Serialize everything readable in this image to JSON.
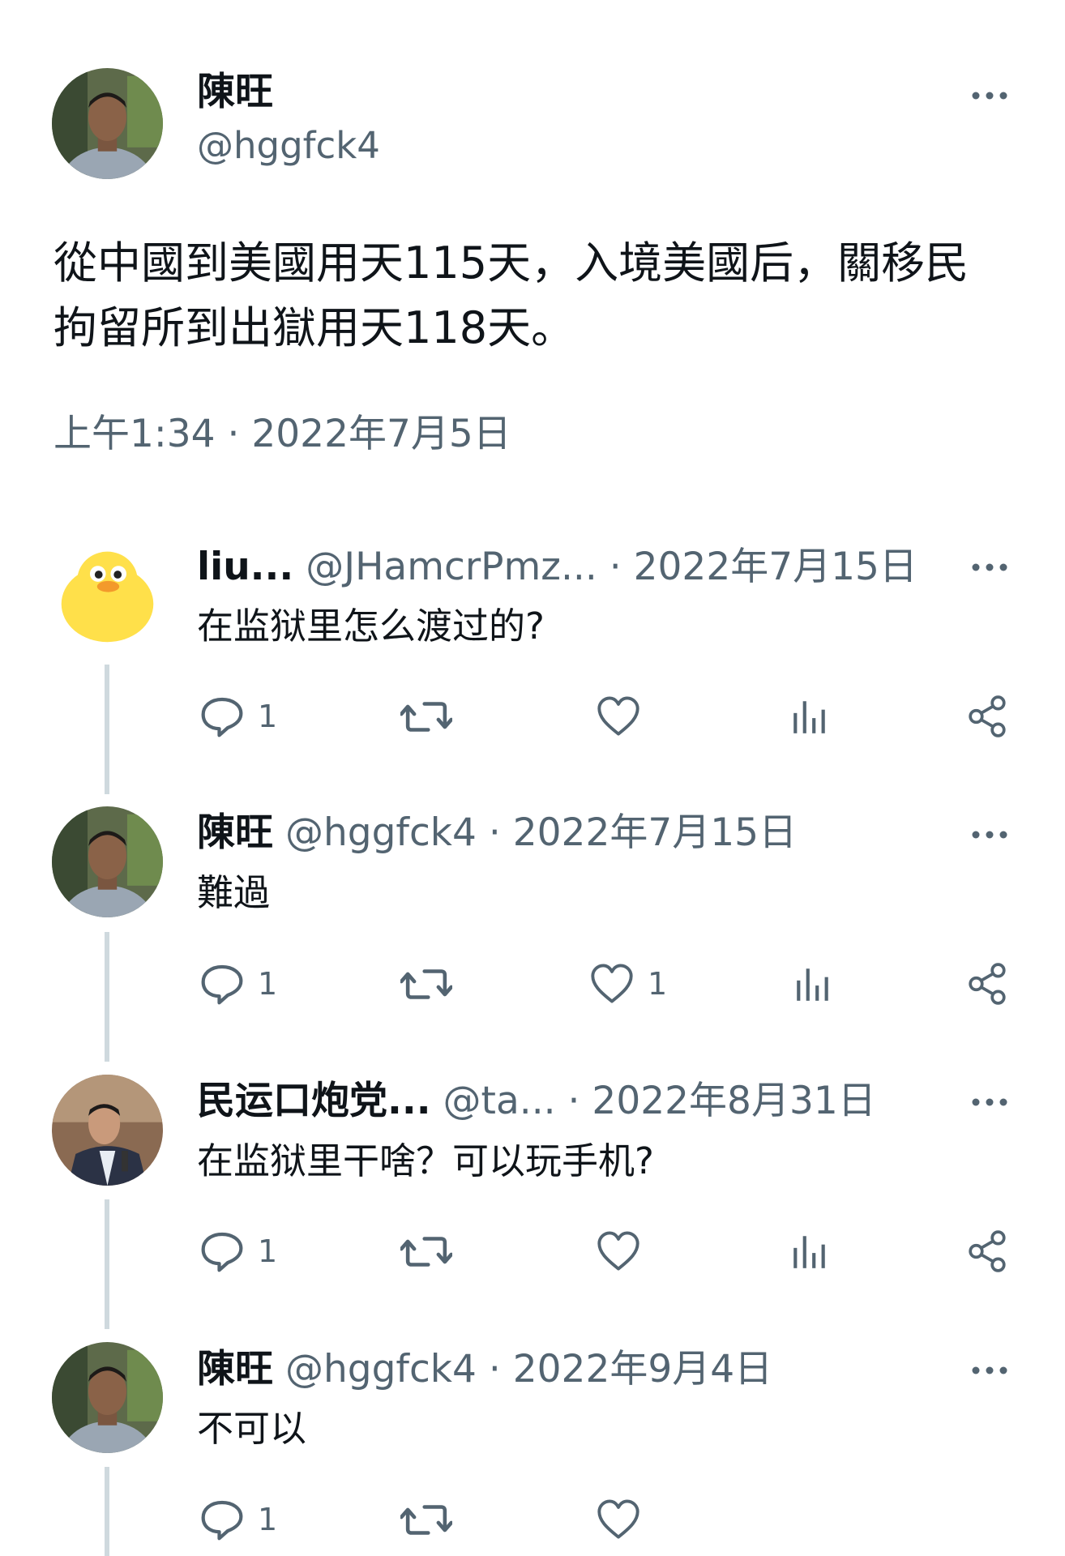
{
  "main": {
    "name": "陳旺",
    "handle": "@hggfck4",
    "text_line1": "從中國到美國用天115天，入境美國后，關移民",
    "text_line2": "拘留所到出獄用天118天。",
    "timestamp": "上午1:34 · 2022年7月5日"
  },
  "replies": [
    {
      "name": "liu...",
      "handle": "@JHamcrPmz...",
      "date": "· 2022年7月15日",
      "text": "在监狱里怎么渡过的?",
      "reply_count": "1",
      "like_count": ""
    },
    {
      "name": "陳旺",
      "handle": "@hggfck4",
      "date": "· 2022年7月15日",
      "text": "難過",
      "reply_count": "1",
      "like_count": "1"
    },
    {
      "name": "民运口炮党...",
      "handle": "@ta...",
      "date": "· 2022年8月31日",
      "text": "在监狱里干啥？可以玩手机?",
      "reply_count": "1",
      "like_count": ""
    },
    {
      "name": "陳旺",
      "handle": "@hggfck4",
      "date": "· 2022年9月4日",
      "text": "不可以",
      "reply_count": "1",
      "like_count": ""
    }
  ],
  "icons": {
    "reply": "reply-icon",
    "retweet": "retweet-icon",
    "like": "heart-icon",
    "views": "views-icon",
    "share": "share-icon",
    "more": "more-icon"
  },
  "colors": {
    "text": "#0f1419",
    "secondary": "#536471",
    "thread_line": "#cfd9de",
    "background": "#ffffff"
  }
}
